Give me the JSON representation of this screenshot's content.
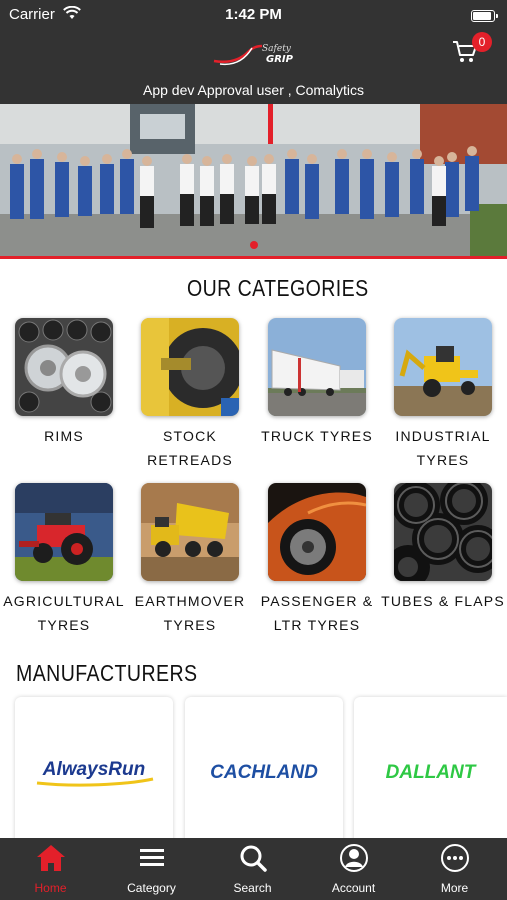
{
  "status_bar": {
    "carrier": "Carrier",
    "time": "1:42 PM"
  },
  "header": {
    "brand_logo_text": "Safety Grip",
    "user_line": "App dev Approval user , Comalytics",
    "cart_count": "0"
  },
  "banner": {
    "slide_count": 1,
    "active_slide": 0
  },
  "categories": {
    "title": "OUR CATEGORIES",
    "items": [
      {
        "label": "RIMS"
      },
      {
        "label": "STOCK RETREADS"
      },
      {
        "label": "TRUCK TYRES"
      },
      {
        "label": "INDUSTRIAL TYRES"
      },
      {
        "label": "AGRICULTURAL TYRES"
      },
      {
        "label": "EARTHMOVER TYRES"
      },
      {
        "label": "PASSENGER & LTR TYRES"
      },
      {
        "label": "TUBES & FLAPS"
      }
    ]
  },
  "manufacturers": {
    "title": "MANUFACTURERS",
    "items": [
      {
        "name": "AlwaysRun",
        "color": "#1c3a8f"
      },
      {
        "name": "CACHLAND",
        "color": "#1e4fa3"
      },
      {
        "name": "DALLANT",
        "color": "#2ec844"
      }
    ]
  },
  "tabbar": {
    "items": [
      {
        "label": "Home",
        "icon": "home-icon",
        "active": true
      },
      {
        "label": "Category",
        "icon": "menu-icon",
        "active": false
      },
      {
        "label": "Search",
        "icon": "search-icon",
        "active": false
      },
      {
        "label": "Account",
        "icon": "account-icon",
        "active": false
      },
      {
        "label": "More",
        "icon": "more-icon",
        "active": false
      }
    ]
  },
  "colors": {
    "header_bg": "#333333",
    "accent": "#e3202a",
    "tabbar_bg": "#333333"
  }
}
